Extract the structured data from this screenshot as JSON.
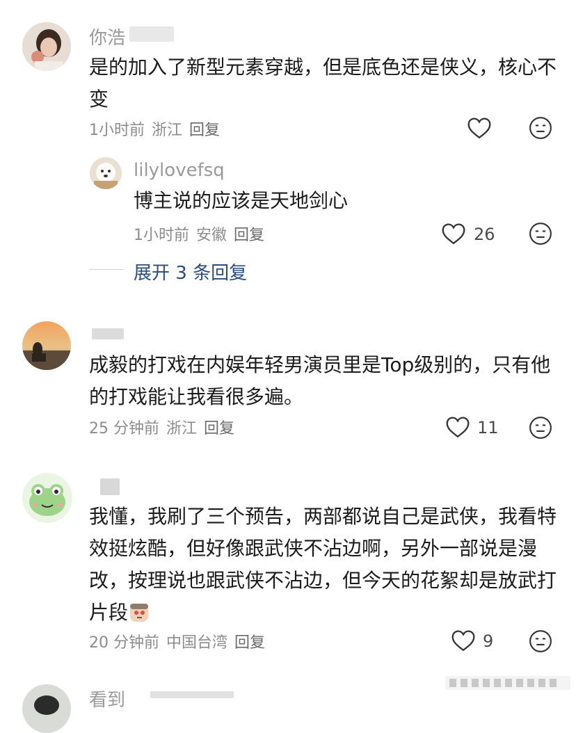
{
  "comments": [
    {
      "username": "你浩",
      "text": "是的加入了新型元素穿越，但是底色还是侠义，核心不变",
      "time": "1小时前",
      "location": "浙江",
      "reply": "回复",
      "likes": ""
    },
    {
      "username": "lilylovefsq",
      "text": "博主说的应该是天地剑心",
      "time": "1小时前",
      "location": "安徽",
      "reply": "回复",
      "likes": "26"
    },
    {
      "username": "",
      "text": "成毅的打戏在内娱年轻男演员里是Top级别的，只有他的打戏能让我看很多遍。",
      "time": "25 分钟前",
      "location": "浙江",
      "reply": "回复",
      "likes": "11"
    },
    {
      "username": "",
      "text": "我懂，我刷了三个预告，两部都说自己是武侠，我看特效挺炫酷，但好像跟武侠不沾边啊，另外一部说是漫改，按理说也跟武侠不沾边，但今天的花絮却是放武打片段",
      "time": "20 分钟前",
      "location": "中国台湾",
      "reply": "回复",
      "likes": "9"
    }
  ],
  "expand_replies": "展开 3 条回复",
  "partial_username": "看到"
}
